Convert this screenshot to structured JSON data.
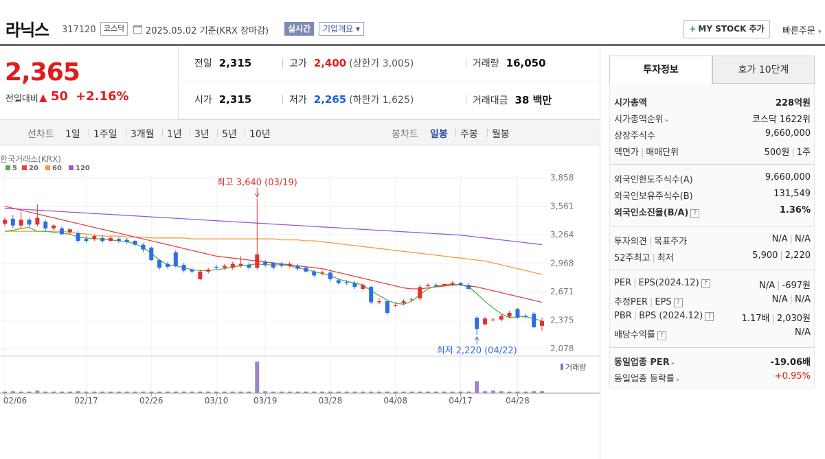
{
  "header": {
    "stock_name": "라닉스",
    "stock_code": "317120",
    "market_badge": "코스닥",
    "date_text": "2025.05.02  기준(KRX 장마감)",
    "realtime_label": "실시간",
    "company_label": "기업개요 ▾",
    "mystock_label": "MY STOCK 추가",
    "quick_order_label": "빠른주문"
  },
  "price": {
    "current": "2,365",
    "change_label": "전일대비",
    "change_value": "50",
    "change_pct": "+2.16%",
    "prev_label": "전일",
    "prev_value": "2,315",
    "high_label": "고가",
    "high_value": "2,400",
    "upper_limit": "(상한가 3,005)",
    "volume_label": "거래량",
    "volume_value": "16,050",
    "open_label": "시가",
    "open_value": "2,315",
    "low_label": "저가",
    "low_value": "2,265",
    "lower_limit": "(하한가 1,625)",
    "amount_label": "거래대금",
    "amount_value": "38 백만"
  },
  "period_bar": {
    "line_label": "선차트",
    "line_periods": [
      "1일",
      "1주일",
      "3개월",
      "1년",
      "3년",
      "5년",
      "10년"
    ],
    "candle_label": "봉차트",
    "candle_periods": [
      "일봉",
      "주봉",
      "월봉"
    ],
    "active_candle": "일봉"
  },
  "chart_data": {
    "type": "candlestick",
    "source_label": "한국거래소(KRX)",
    "legend": [
      "5",
      "20",
      "60",
      "120"
    ],
    "legend_colors": [
      "#4fb24f",
      "#e84141",
      "#f39a36",
      "#9b59d6"
    ],
    "y_ticks": [
      "3,858",
      "3,561",
      "3,264",
      "2,968",
      "2,671",
      "2,375",
      "2,078"
    ],
    "ylim": [
      2078,
      3858
    ],
    "x_labels": [
      "02/06",
      "02/17",
      "02/26",
      "03/10",
      "03/19",
      "03/28",
      "04/08",
      "04/17",
      "04/28"
    ],
    "high_annotation": "최고 3,640 (03/19)",
    "low_annotation": "최저 2,220 (04/22)",
    "volume_label": "거래량",
    "candles": [
      {
        "o": 3380,
        "c": 3420,
        "h": 3450,
        "l": 3350
      },
      {
        "o": 3430,
        "c": 3360,
        "h": 3470,
        "l": 3330
      },
      {
        "o": 3360,
        "c": 3420,
        "h": 3500,
        "l": 3320
      },
      {
        "o": 3420,
        "c": 3370,
        "h": 3440,
        "l": 3340
      },
      {
        "o": 3370,
        "c": 3440,
        "h": 3580,
        "l": 3350
      },
      {
        "o": 3400,
        "c": 3330,
        "h": 3420,
        "l": 3300
      },
      {
        "o": 3330,
        "c": 3360,
        "h": 3380,
        "l": 3310
      },
      {
        "o": 3330,
        "c": 3270,
        "h": 3350,
        "l": 3260
      },
      {
        "o": 3290,
        "c": 3320,
        "h": 3330,
        "l": 3270
      },
      {
        "o": 3280,
        "c": 3200,
        "h": 3310,
        "l": 3180
      },
      {
        "o": 3220,
        "c": 3200,
        "h": 3250,
        "l": 3180
      },
      {
        "o": 3220,
        "c": 3250,
        "h": 3270,
        "l": 3200
      },
      {
        "o": 3230,
        "c": 3200,
        "h": 3260,
        "l": 3180
      },
      {
        "o": 3200,
        "c": 3230,
        "h": 3250,
        "l": 3190
      },
      {
        "o": 3220,
        "c": 3200,
        "h": 3240,
        "l": 3180
      },
      {
        "o": 3210,
        "c": 3190,
        "h": 3230,
        "l": 3170
      },
      {
        "o": 3200,
        "c": 3160,
        "h": 3210,
        "l": 3140
      },
      {
        "o": 3160,
        "c": 3110,
        "h": 3180,
        "l": 3080
      },
      {
        "o": 3130,
        "c": 3000,
        "h": 3140,
        "l": 2990
      },
      {
        "o": 3000,
        "c": 2920,
        "h": 3010,
        "l": 2900
      },
      {
        "o": 2960,
        "c": 2930,
        "h": 2980,
        "l": 2910
      },
      {
        "o": 3080,
        "c": 2940,
        "h": 3100,
        "l": 2920
      },
      {
        "o": 2950,
        "c": 2890,
        "h": 2970,
        "l": 2870
      },
      {
        "o": 2900,
        "c": 2880,
        "h": 2920,
        "l": 2860
      },
      {
        "o": 2800,
        "c": 2880,
        "h": 2900,
        "l": 2790
      },
      {
        "o": 2880,
        "c": 2900,
        "h": 2920,
        "l": 2860
      },
      {
        "o": 2930,
        "c": 2920,
        "h": 2950,
        "l": 2900
      },
      {
        "o": 2920,
        "c": 2940,
        "h": 2960,
        "l": 2900
      },
      {
        "o": 2920,
        "c": 2960,
        "h": 2980,
        "l": 2900
      },
      {
        "o": 2940,
        "c": 2960,
        "h": 3040,
        "l": 2920
      },
      {
        "o": 2950,
        "c": 2920,
        "h": 2980,
        "l": 2900
      },
      {
        "o": 2920,
        "c": 3060,
        "h": 3640,
        "l": 2900
      },
      {
        "o": 2980,
        "c": 2950,
        "h": 3000,
        "l": 2930
      },
      {
        "o": 2970,
        "c": 2920,
        "h": 2980,
        "l": 2900
      },
      {
        "o": 2960,
        "c": 2940,
        "h": 2980,
        "l": 2920
      },
      {
        "o": 2940,
        "c": 2960,
        "h": 2980,
        "l": 2920
      },
      {
        "o": 2940,
        "c": 2910,
        "h": 2960,
        "l": 2890
      },
      {
        "o": 2920,
        "c": 2880,
        "h": 2940,
        "l": 2870
      },
      {
        "o": 2880,
        "c": 2840,
        "h": 2900,
        "l": 2820
      },
      {
        "o": 2860,
        "c": 2870,
        "h": 2890,
        "l": 2840
      },
      {
        "o": 2870,
        "c": 2800,
        "h": 2900,
        "l": 2780
      },
      {
        "o": 2790,
        "c": 2760,
        "h": 2810,
        "l": 2740
      },
      {
        "o": 2770,
        "c": 2760,
        "h": 2790,
        "l": 2740
      },
      {
        "o": 2760,
        "c": 2720,
        "h": 2780,
        "l": 2700
      },
      {
        "o": 2700,
        "c": 2740,
        "h": 2760,
        "l": 2680
      },
      {
        "o": 2720,
        "c": 2560,
        "h": 2730,
        "l": 2540
      },
      {
        "o": 2560,
        "c": 2570,
        "h": 2600,
        "l": 2540
      },
      {
        "o": 2570,
        "c": 2450,
        "h": 2580,
        "l": 2430
      },
      {
        "o": 2530,
        "c": 2530,
        "h": 2560,
        "l": 2510
      },
      {
        "o": 2550,
        "c": 2570,
        "h": 2590,
        "l": 2530
      },
      {
        "o": 2590,
        "c": 2590,
        "h": 2610,
        "l": 2570
      },
      {
        "o": 2600,
        "c": 2720,
        "h": 2740,
        "l": 2580
      },
      {
        "o": 2730,
        "c": 2740,
        "h": 2760,
        "l": 2720
      },
      {
        "o": 2740,
        "c": 2730,
        "h": 2760,
        "l": 2720
      },
      {
        "o": 2740,
        "c": 2750,
        "h": 2760,
        "l": 2720
      },
      {
        "o": 2740,
        "c": 2760,
        "h": 2780,
        "l": 2730
      },
      {
        "o": 2760,
        "c": 2740,
        "h": 2770,
        "l": 2730
      },
      {
        "o": 2740,
        "c": 2700,
        "h": 2760,
        "l": 2690
      },
      {
        "o": 2400,
        "c": 2280,
        "h": 2420,
        "l": 2220
      },
      {
        "o": 2330,
        "c": 2390,
        "h": 2410,
        "l": 2320
      },
      {
        "o": 2380,
        "c": 2380,
        "h": 2400,
        "l": 2360
      },
      {
        "o": 2380,
        "c": 2420,
        "h": 2440,
        "l": 2360
      },
      {
        "o": 2410,
        "c": 2450,
        "h": 2470,
        "l": 2390
      },
      {
        "o": 2490,
        "c": 2400,
        "h": 2500,
        "l": 2390
      },
      {
        "o": 2420,
        "c": 2410,
        "h": 2440,
        "l": 2390
      },
      {
        "o": 2440,
        "c": 2300,
        "h": 2460,
        "l": 2290
      },
      {
        "o": 2315,
        "c": 2365,
        "h": 2400,
        "l": 2265
      }
    ],
    "volumes": [
      5,
      6,
      5,
      5,
      8,
      5,
      5,
      5,
      5,
      6,
      5,
      5,
      5,
      5,
      5,
      5,
      5,
      5,
      5,
      5,
      5,
      5,
      5,
      5,
      5,
      5,
      5,
      5,
      5,
      5,
      5,
      100,
      6,
      5,
      5,
      5,
      5,
      5,
      5,
      5,
      5,
      5,
      5,
      5,
      5,
      5,
      5,
      5,
      5,
      5,
      5,
      5,
      5,
      5,
      5,
      5,
      5,
      5,
      38,
      6,
      8,
      6,
      5,
      5,
      5,
      6,
      6
    ],
    "ma": {
      "5": [
        3300,
        3310,
        3330,
        3340,
        3300,
        3300,
        3290,
        3280,
        3270,
        3240,
        3230,
        3220,
        3220,
        3210,
        3200,
        3190,
        3170,
        3130,
        3070,
        3000,
        2950,
        2940,
        2920,
        2900,
        2890,
        2890,
        2900,
        2910,
        2930,
        2940,
        2950,
        2960,
        2950,
        2950,
        2950,
        2940,
        2920,
        2900,
        2880,
        2860,
        2840,
        2800,
        2780,
        2760,
        2740,
        2680,
        2630,
        2580,
        2550,
        2540,
        2570,
        2640,
        2700,
        2730,
        2740,
        2750,
        2740,
        2720,
        2650,
        2570,
        2500,
        2440,
        2400,
        2410,
        2410,
        2390,
        2365
      ],
      "20": [
        3560,
        3540,
        3520,
        3500,
        3480,
        3460,
        3440,
        3420,
        3400,
        3380,
        3360,
        3340,
        3320,
        3300,
        3280,
        3260,
        3240,
        3220,
        3200,
        3180,
        3160,
        3140,
        3120,
        3100,
        3080,
        3060,
        3040,
        3030,
        3020,
        3010,
        3000,
        2990,
        2980,
        2970,
        2960,
        2950,
        2940,
        2930,
        2920,
        2910,
        2890,
        2870,
        2850,
        2830,
        2810,
        2790,
        2770,
        2750,
        2730,
        2710,
        2700,
        2700,
        2710,
        2720,
        2730,
        2740,
        2740,
        2730,
        2720,
        2700,
        2680,
        2660,
        2640,
        2620,
        2600,
        2580,
        2560
      ],
      "60": [
        3300,
        3300,
        3300,
        3300,
        3300,
        3300,
        3300,
        3300,
        3290,
        3280,
        3270,
        3260,
        3250,
        3250,
        3250,
        3240,
        3240,
        3240,
        3230,
        3230,
        3230,
        3230,
        3230,
        3220,
        3220,
        3220,
        3220,
        3220,
        3220,
        3220,
        3220,
        3220,
        3220,
        3220,
        3210,
        3210,
        3210,
        3200,
        3200,
        3190,
        3180,
        3170,
        3160,
        3150,
        3140,
        3130,
        3120,
        3110,
        3100,
        3090,
        3080,
        3070,
        3060,
        3050,
        3040,
        3030,
        3020,
        3010,
        3000,
        2990,
        2970,
        2950,
        2930,
        2910,
        2890,
        2870,
        2850
      ],
      "120": [
        3540,
        3535,
        3530,
        3525,
        3520,
        3515,
        3510,
        3505,
        3500,
        3495,
        3490,
        3485,
        3480,
        3475,
        3470,
        3465,
        3460,
        3455,
        3450,
        3445,
        3440,
        3435,
        3430,
        3425,
        3420,
        3415,
        3410,
        3405,
        3400,
        3395,
        3390,
        3385,
        3380,
        3375,
        3370,
        3365,
        3360,
        3355,
        3350,
        3345,
        3340,
        3335,
        3330,
        3325,
        3320,
        3315,
        3310,
        3305,
        3300,
        3295,
        3290,
        3285,
        3280,
        3275,
        3270,
        3265,
        3260,
        3250,
        3240,
        3230,
        3220,
        3210,
        3200,
        3190,
        3180,
        3170,
        3160
      ]
    }
  },
  "info": {
    "tab_active": "투자정보",
    "tab_inactive": "호가 10단계",
    "rows": [
      {
        "label": "시가총액",
        "value": "228억원"
      },
      {
        "label": "시가총액순위",
        "value": "코스닥 1622위"
      },
      {
        "label": "상장주식수",
        "value": "9,660,000"
      },
      {
        "label": "액면가",
        "label2": "매매단위",
        "value": "500원",
        "value2": "1주"
      },
      {
        "label": "외국인한도주식수(A)",
        "value": "9,660,000"
      },
      {
        "label": "외국인보유주식수(B)",
        "value": "131,549"
      },
      {
        "label": "외국인소진율(B/A)",
        "value": "1.36%"
      },
      {
        "label": "투자의견",
        "label2": "목표주가",
        "value": "N/A",
        "value2": "N/A"
      },
      {
        "label": "52주최고",
        "label2": "최저",
        "value": "5,900",
        "value2": "2,220"
      },
      {
        "label": "PER",
        "label2": "EPS(2024.12)",
        "value": "N/A",
        "value2": "-697원"
      },
      {
        "label": "추정PER",
        "label2": "EPS",
        "value": "N/A",
        "value2": "N/A"
      },
      {
        "label": "PBR",
        "label2": "BPS (2024.12)",
        "value": "1.17배",
        "value2": "2,030원"
      },
      {
        "label": "배당수익률",
        "value": "N/A"
      },
      {
        "label": "동일업종 PER",
        "value": "-19.06배"
      },
      {
        "label": "동일업종 등락률",
        "value": "+0.95%"
      }
    ]
  }
}
